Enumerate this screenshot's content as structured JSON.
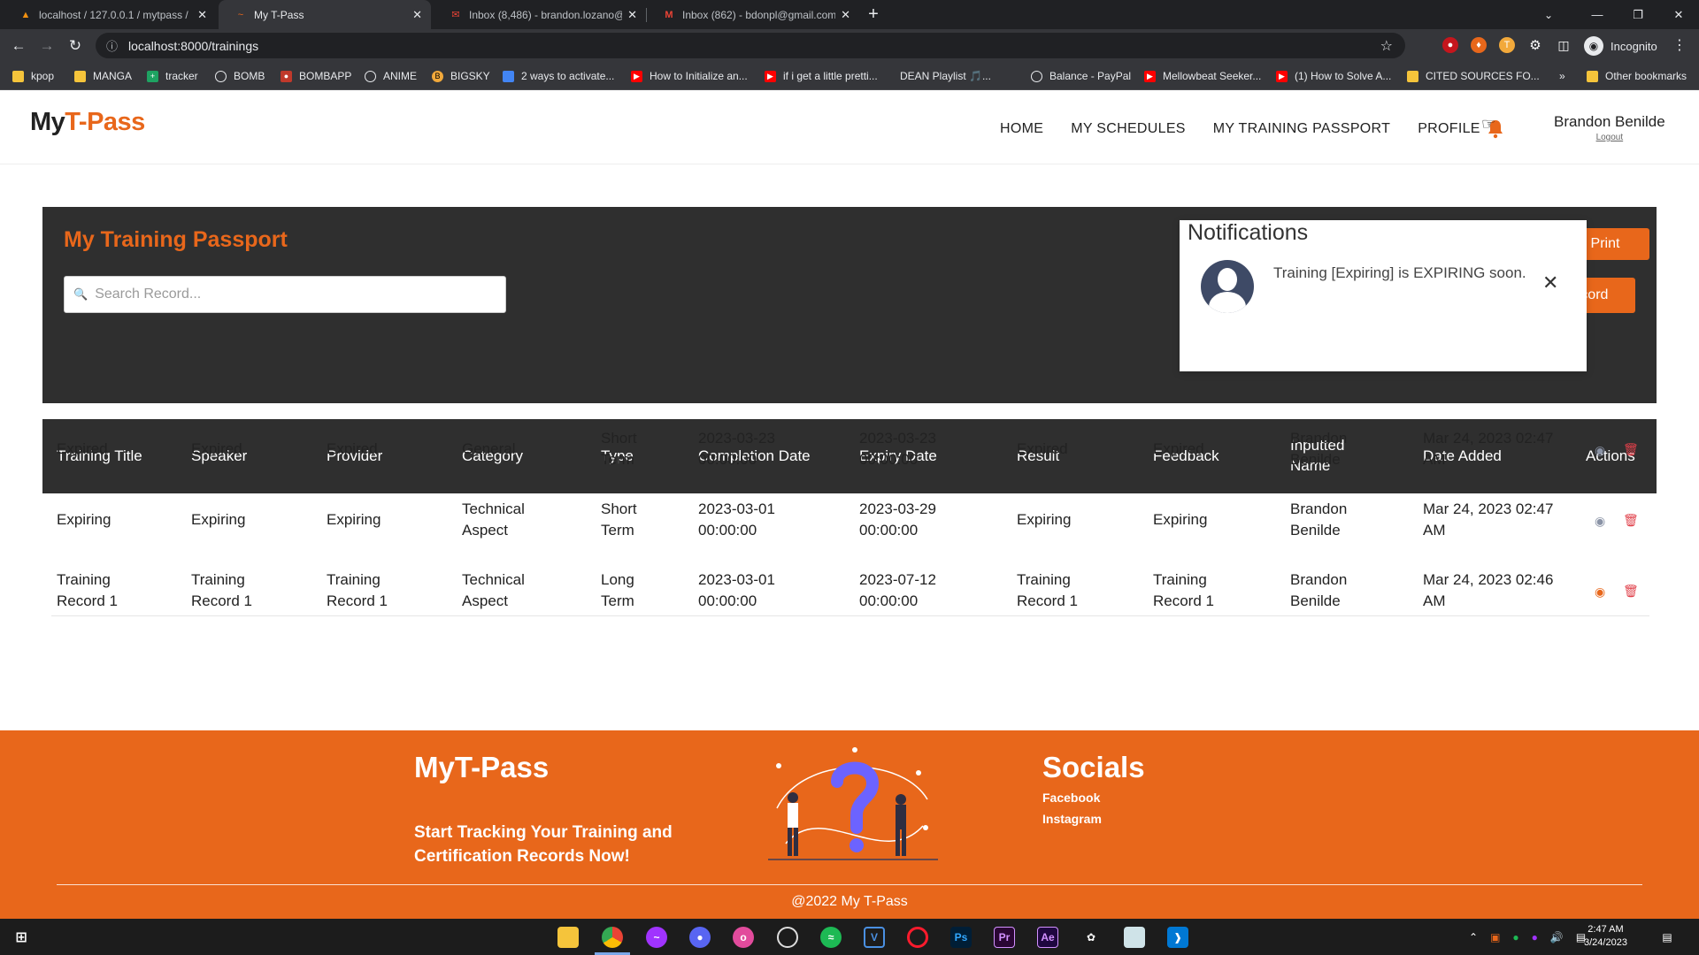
{
  "browser": {
    "tabs": [
      {
        "label": "localhost / 127.0.0.1 / mytpass / ...",
        "icon": "phpmyadmin-icon"
      },
      {
        "label": "My T-Pass",
        "icon": "mytpass-icon"
      },
      {
        "label": "Inbox (8,486) - brandon.lozano@...",
        "icon": "mail-icon"
      },
      {
        "label": "Inbox (862) - bdonpl@gmail.com",
        "icon": "gmail-icon"
      }
    ],
    "url": "localhost:8000/trainings",
    "profile_label": "Incognito",
    "bookmarks": [
      "kpop",
      "MANGA",
      "tracker",
      "BOMB",
      "BOMBAPP",
      "ANIME",
      "BIGSKY",
      "2 ways to activate...",
      "How to Initialize an...",
      "if i get a little pretti...",
      "DEAN Playlist 🎵...",
      "Balance - PayPal",
      "Mellowbeat Seeker...",
      "(1) How to Solve A...",
      "CITED SOURCES FO..."
    ],
    "other_bookmarks": "Other bookmarks",
    "overflow": "»"
  },
  "site": {
    "logo_a": "My",
    "logo_b": "T-Pass",
    "nav": [
      "HOME",
      "MY SCHEDULES",
      "MY TRAINING PASSPORT",
      "PROFILE"
    ],
    "user_name": "Brandon Benilde",
    "logout": "Logout"
  },
  "panel": {
    "title": "My Training Passport",
    "search_placeholder": "Search Record...",
    "print_label": "Print",
    "add_label": "Add Record",
    "add_plus": "+"
  },
  "table": {
    "headers": [
      "Training Title",
      "Speaker",
      "Provider",
      "Category",
      "Type",
      "Completion Date",
      "Expiry Date",
      "Result",
      "Feedback",
      "Inputted Name",
      "Date Added",
      "Actions"
    ],
    "rows": [
      {
        "title": "Expired",
        "speaker": "Expired",
        "provider": "Expired",
        "category": "General",
        "type": "Short Term",
        "completion": "2023-03-23 00:00:00",
        "expiry": "2023-03-23 00:00:00",
        "result": "Expired",
        "feedback": "Expired",
        "inputted": "Brandon Benilde",
        "added": "Mar 24, 2023 02:47 AM"
      },
      {
        "title": "Expiring",
        "speaker": "Expiring",
        "provider": "Expiring",
        "category": "Technical Aspect",
        "type": "Short Term",
        "completion": "2023-03-01 00:00:00",
        "expiry": "2023-03-29 00:00:00",
        "result": "Expiring",
        "feedback": "Expiring",
        "inputted": "Brandon Benilde",
        "added": "Mar 24, 2023 02:47 AM"
      },
      {
        "title": "Training Record 1",
        "speaker": "Training Record 1",
        "provider": "Training Record 1",
        "category": "Technical Aspect",
        "type": "Long Term",
        "completion": "2023-03-01 00:00:00",
        "expiry": "2023-07-12 00:00:00",
        "result": "Training Record 1",
        "feedback": "Training Record 1",
        "inputted": "Brandon Benilde",
        "added": "Mar 24, 2023 02:46 AM"
      }
    ]
  },
  "notifications": {
    "title": "Notifications",
    "items": [
      {
        "message": "Training [Expiring] is EXPIRING soon."
      }
    ]
  },
  "footer": {
    "title": "MyT-Pass",
    "tagline": "Start Tracking Your Training and Certification Records Now!",
    "socials_title": "Socials",
    "links": [
      "Facebook",
      "Instagram"
    ],
    "copyright": "@2022 My T-Pass"
  },
  "taskbar": {
    "time": "2:47 AM",
    "date": "3/24/2023"
  },
  "colors": {
    "accent": "#e8671b",
    "panel_bg": "#2f2f2f",
    "chrome_bg": "#202124"
  }
}
